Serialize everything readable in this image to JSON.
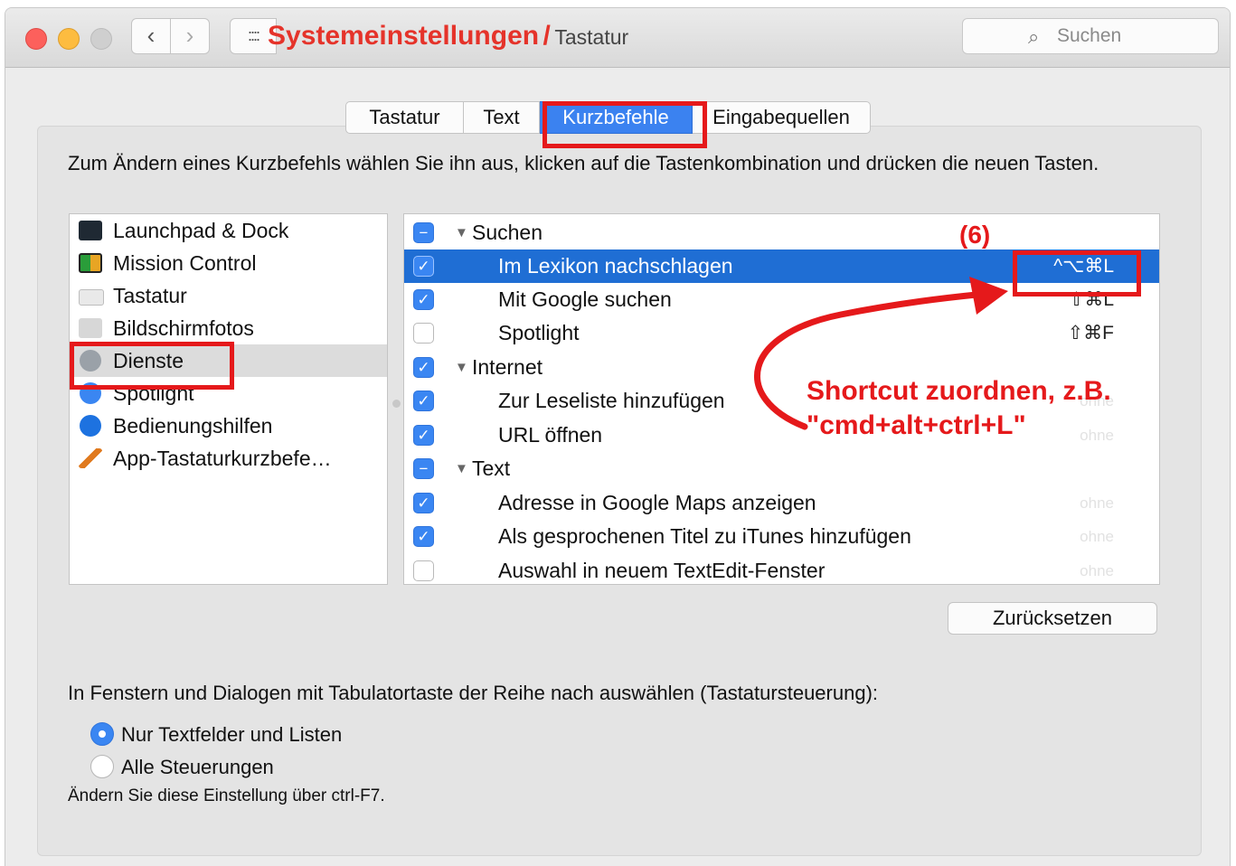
{
  "window": {
    "title_main": "Systemeinstellungen",
    "title_sep": "/",
    "title_sub": "Tastatur",
    "grid_icon": "::::",
    "nav_back": "‹",
    "nav_forward": "›",
    "search_placeholder": "Suchen",
    "search_icon": "⌕"
  },
  "tabs": [
    {
      "label": "Tastatur",
      "selected": false
    },
    {
      "label": "Text",
      "selected": false
    },
    {
      "label": "Kurzbefehle",
      "selected": true
    },
    {
      "label": "Eingabequellen",
      "selected": false
    }
  ],
  "description": "Zum Ändern eines Kurzbefehls wählen Sie ihn aus, klicken auf die Tastenkombination und drücken die neuen Tasten.",
  "categories": [
    {
      "label": "Launchpad & Dock",
      "icon": "launchpad-dock-icon"
    },
    {
      "label": "Mission Control",
      "icon": "mission-control-icon"
    },
    {
      "label": "Tastatur",
      "icon": "keyboard-icon"
    },
    {
      "label": "Bildschirmfotos",
      "icon": "screenshot-icon"
    },
    {
      "label": "Dienste",
      "icon": "gear-icon",
      "selected": true
    },
    {
      "label": "Spotlight",
      "icon": "spotlight-icon"
    },
    {
      "label": "Bedienungshilfen",
      "icon": "accessibility-icon"
    },
    {
      "label": "App-Tastaturkurzbefe…",
      "icon": "app-shortcuts-icon"
    }
  ],
  "services": [
    {
      "type": "group",
      "label": "Suchen",
      "check": "mixed",
      "triangle": "▼"
    },
    {
      "type": "item",
      "label": "Im Lexikon nachschlagen",
      "check": "on",
      "shortcut": "^⌥⌘L",
      "selected": true
    },
    {
      "type": "item",
      "label": "Mit Google suchen",
      "check": "on",
      "shortcut": "⇧⌘L"
    },
    {
      "type": "item",
      "label": "Spotlight",
      "check": "off",
      "shortcut": "⇧⌘F"
    },
    {
      "type": "group",
      "label": "Internet",
      "check": "on",
      "triangle": "▼"
    },
    {
      "type": "item",
      "label": "Zur Leseliste hinzufügen",
      "check": "on",
      "shortcut": "ohne",
      "dim": true
    },
    {
      "type": "item",
      "label": "URL öffnen",
      "check": "on",
      "shortcut": "ohne",
      "dim": true
    },
    {
      "type": "group",
      "label": "Text",
      "check": "mixed",
      "triangle": "▼"
    },
    {
      "type": "item",
      "label": "Adresse in Google Maps anzeigen",
      "check": "on",
      "shortcut": "ohne",
      "dim": true
    },
    {
      "type": "item",
      "label": "Als gesprochenen Titel zu iTunes hinzufügen",
      "check": "on",
      "shortcut": "ohne",
      "dim": true
    },
    {
      "type": "item",
      "label": "Auswahl in neuem TextEdit-Fenster",
      "check": "off",
      "shortcut": "ohne",
      "dim": true
    }
  ],
  "annotation": {
    "number": "(6)",
    "line1": "Shortcut zuordnen, z.B.",
    "line2": "\"cmd+alt+ctrl+L\"",
    "color": "#e5191b"
  },
  "reset_label": "Zurücksetzen",
  "tab_navigation": {
    "label": "In Fenstern und Dialogen mit Tabulatortaste der Reihe nach auswählen (Tastatursteuerung):",
    "options": [
      {
        "label": "Nur Textfelder und Listen",
        "selected": true
      },
      {
        "label": "Alle Steuerungen",
        "selected": false
      }
    ],
    "hint": "Ändern Sie diese Einstellung über ctrl-F7."
  },
  "colors": {
    "accent": "#3a86f2",
    "selection": "#1f6ed4",
    "title_red": "#e5332a"
  }
}
